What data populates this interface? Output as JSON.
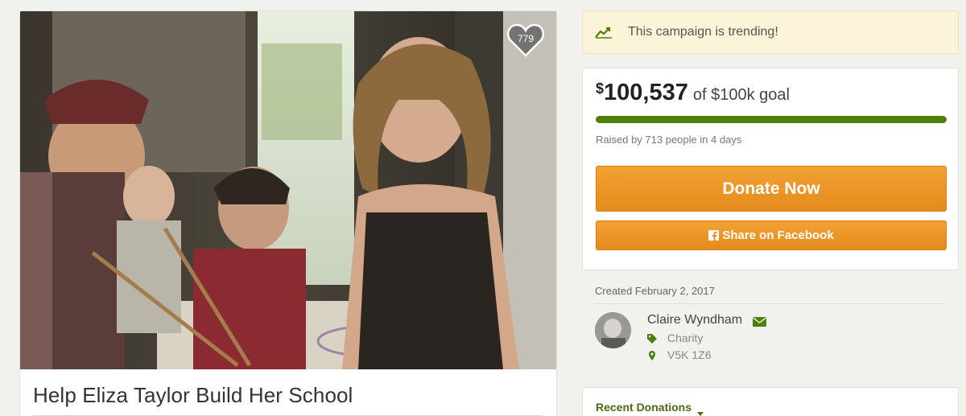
{
  "campaign": {
    "title": "Help Eliza Taylor Build Her School",
    "likes": "779",
    "photo_icon": "campaign-photo"
  },
  "trending": {
    "icon": "trending-up-icon",
    "text": "This campaign is trending!"
  },
  "donation": {
    "currency_symbol": "$",
    "raised": "100,537",
    "goal_text": "of $100k goal",
    "progress_fraction": 1.0,
    "raised_by": "Raised by 713 people in 4 days",
    "donate_label": "Donate Now",
    "share_label": "Share on Facebook"
  },
  "organizer": {
    "created": "Created February 2, 2017",
    "name": "Claire Wyndham",
    "category": "Charity",
    "location": "V5K 1Z6"
  },
  "recent": {
    "label": "Recent Donations"
  },
  "colors": {
    "accent_green": "#4f7f08",
    "button_orange": "#ec9526",
    "trending_bg": "#fcf4d8"
  }
}
